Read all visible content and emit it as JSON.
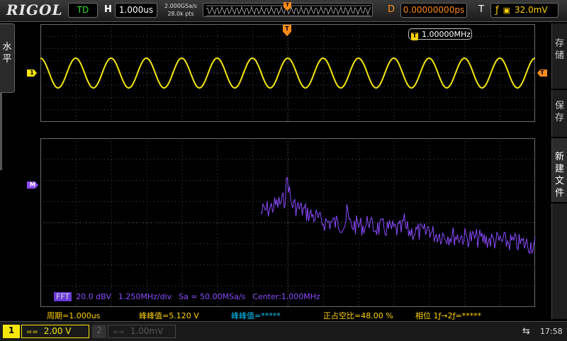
{
  "header": {
    "logo": "RIGOL",
    "run_state": "TD",
    "timebase_label": "H",
    "timebase": "1.000us",
    "sample_rate": "2.000GSa/s",
    "memory_depth": "28.0k pts",
    "delay_label": "D",
    "delay": "0.00000000ps",
    "trigger_label": "T",
    "trigger_level": "32.0mV"
  },
  "left_menu": {
    "label_1": "水",
    "label_2": "平"
  },
  "right_menu": {
    "item_1": [
      "存",
      "储"
    ],
    "item_2": [
      "保",
      "存"
    ],
    "item_3": [
      "新",
      "建",
      "文",
      "件"
    ]
  },
  "markers": {
    "ch1": "1",
    "trigger": "T",
    "math": "M"
  },
  "freq_counter": {
    "icon": "T",
    "value": "1.00000MHz"
  },
  "fft_info": {
    "tag": "FFT",
    "scale": "20.0 dBV",
    "span": "1.250MHz/div",
    "sample": "Sa = 50.00MSa/s",
    "center": "Center:1.000MHz"
  },
  "measurements": {
    "period": "周期=1.000us",
    "vpp": "峰峰值=5.120 V",
    "vpp2": "峰峰值=*****",
    "duty": "正占空比=48.00 %",
    "phase": "相位 1ƒ→2ƒ=*****"
  },
  "channels": {
    "ch1_num": "1",
    "ch1_coupling": "==",
    "ch1_scale": "2.00 V",
    "ch2_num": "2",
    "ch2_coupling": "==",
    "ch2_scale": "1.00mV"
  },
  "status": {
    "usb_icon": "usb-icon",
    "time": "17:58"
  },
  "colors": {
    "ch1": "#f5e60a",
    "math": "#8a4cff",
    "trigger": "#ff8c1a",
    "counter": "#00c8ff"
  }
}
